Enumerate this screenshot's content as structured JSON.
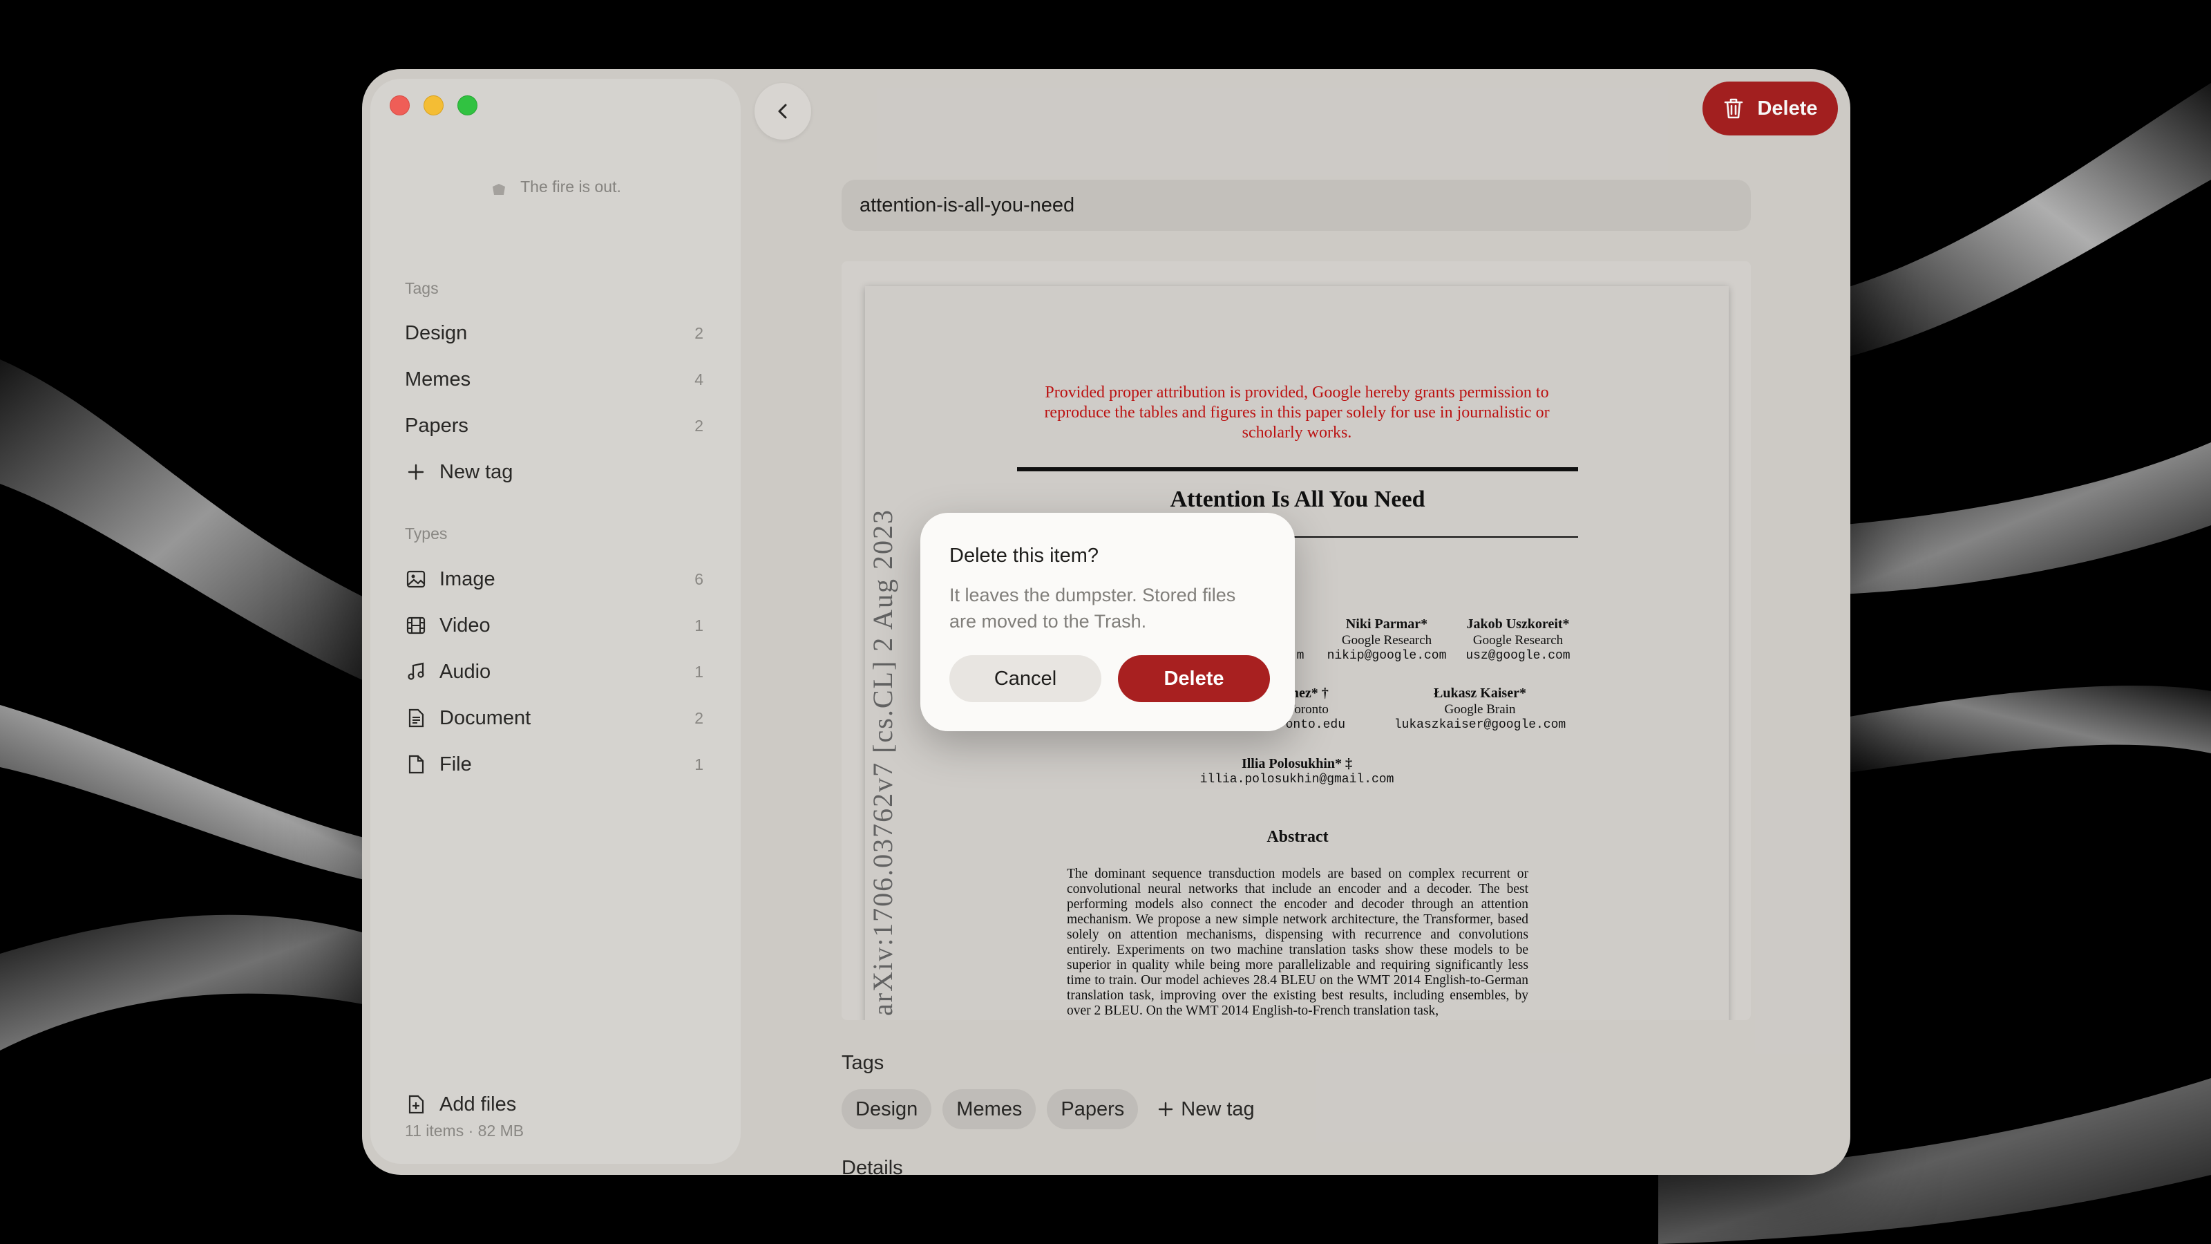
{
  "window": {
    "back_label": "",
    "delete_label": "Delete"
  },
  "sidebar": {
    "status": "The fire is out.",
    "tags_title": "Tags",
    "tags": [
      {
        "label": "Design",
        "count": "2"
      },
      {
        "label": "Memes",
        "count": "4"
      },
      {
        "label": "Papers",
        "count": "2"
      }
    ],
    "new_tag_label": "New tag",
    "types_title": "Types",
    "types": [
      {
        "label": "Image",
        "count": "6",
        "icon": "image-icon"
      },
      {
        "label": "Video",
        "count": "1",
        "icon": "film-icon"
      },
      {
        "label": "Audio",
        "count": "1",
        "icon": "music-note-icon"
      },
      {
        "label": "Document",
        "count": "2",
        "icon": "document-icon"
      },
      {
        "label": "File",
        "count": "1",
        "icon": "file-icon"
      }
    ],
    "add_files_label": "Add files",
    "storage": "11 items · 82 MB"
  },
  "detail": {
    "title_value": "attention-is-all-you-need",
    "tags_heading": "Tags",
    "tags": [
      "Design",
      "Memes",
      "Papers"
    ],
    "new_tag_label": "New tag",
    "details_heading": "Details"
  },
  "paper": {
    "notice": "Provided proper attribution is provided, Google hereby grants permission to reproduce the tables and figures in this paper solely for use in journalistic or scholarly works.",
    "title": "Attention Is All You Need",
    "arxiv_id": "arXiv:1706.03762v7  [cs.CL]  2 Aug 2023",
    "authors": [
      {
        "name": "Niki Parmar*",
        "affil": "Google Research",
        "email": "nikip@google.com"
      },
      {
        "name": "Jakob Uszkoreit*",
        "affil": "Google Research",
        "email": "usz@google.com"
      },
      {
        "name": "Łukasz Kaiser*",
        "affil": "Google Brain",
        "email": "lukaszkaiser@google.com"
      },
      {
        "name": "Illia Polosukhin* ‡",
        "affil": "",
        "email": "illia.polosukhin@gmail.com"
      }
    ],
    "partial": {
      "a": "m",
      "b": "mez* †",
      "c": "Toronto",
      "d": "oronto.edu"
    },
    "abstract_title": "Abstract",
    "abstract": "The dominant sequence transduction models are based on complex recurrent or convolutional neural networks that include an encoder and a decoder. The best performing models also connect the encoder and decoder through an attention mechanism. We propose a new simple network architecture, the Transformer, based solely on attention mechanisms, dispensing with recurrence and convolutions entirely. Experiments on two machine translation tasks show these models to be superior in quality while being more parallelizable and requiring significantly less time to train. Our model achieves 28.4 BLEU on the WMT 2014 English-to-German translation task, improving over the existing best results, including ensembles, by over 2 BLEU. On the WMT 2014 English-to-French translation task,"
  },
  "modal": {
    "title": "Delete this item?",
    "body": "It leaves the dumpster. Stored files are moved to the Trash.",
    "cancel_label": "Cancel",
    "delete_label": "Delete"
  },
  "colors": {
    "accent_red": "#a82020",
    "window_bg": "#d4d1cc",
    "sidebar_bg": "#dcdad6"
  }
}
